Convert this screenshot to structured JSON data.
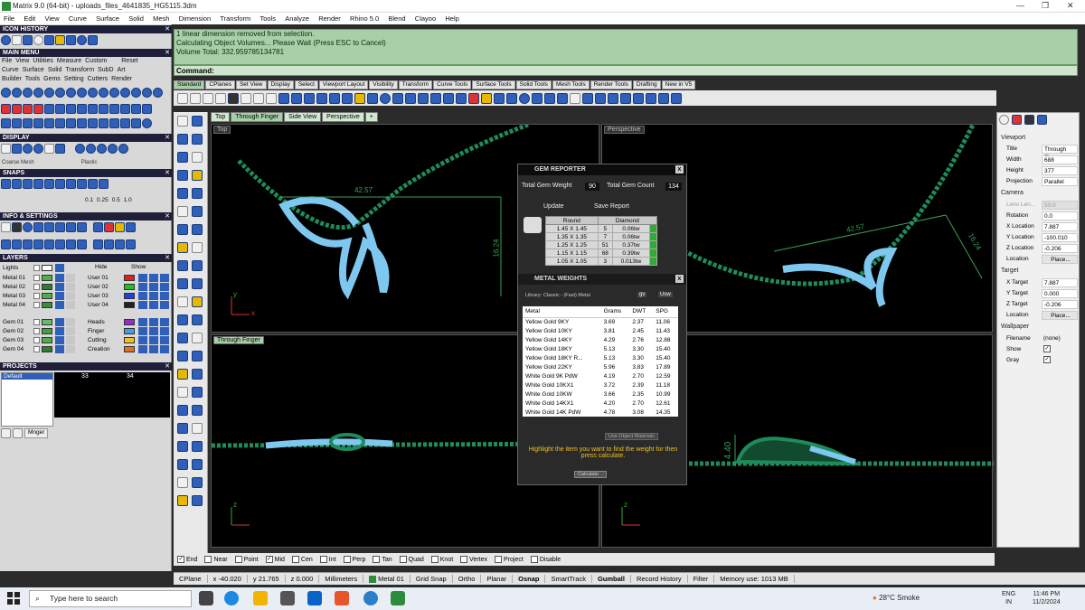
{
  "window": {
    "title": "Matrix 9.0 (64-bit) - uploads_files_4641835_HG5115.3dm",
    "min": "—",
    "max": "❐",
    "close": "✕"
  },
  "menu": [
    "File",
    "Edit",
    "View",
    "Curve",
    "Surface",
    "Solid",
    "Mesh",
    "Dimension",
    "Transform",
    "Tools",
    "Analyze",
    "Render",
    "Rhino 5.0",
    "Blend",
    "Clayoo",
    "Help"
  ],
  "left": {
    "icon_history": "ICON HISTORY",
    "main_menu": "MAIN MENU",
    "main_menu_row1": [
      "File",
      "View",
      "Utilities",
      "Measure",
      "Custom",
      "Reset"
    ],
    "main_menu_row2": [
      "Curve",
      "Surface",
      "Solid",
      "Transform",
      "SubD",
      "Art"
    ],
    "main_menu_row3": [
      "Builder",
      "Tools",
      "Gems",
      "Setting",
      "Cutters",
      "Render"
    ],
    "display": "DISPLAY",
    "display_left": "Coarse Mesh",
    "display_right": "Plastic",
    "snaps": "SNAPS",
    "snap_vals": [
      "0.1",
      "0.25",
      "0.5",
      "1.0"
    ],
    "info_settings": "INFO & SETTINGS",
    "layers": "LAYERS",
    "lights": "Lights",
    "hide": "Hide",
    "show": "Show",
    "layers_left": [
      "Metal 01",
      "Metal 02",
      "Metal 03",
      "Metal 04",
      "",
      "Gem 01",
      "Gem 02",
      "Gem 03",
      "Gem 04"
    ],
    "layers_right": [
      "User 01",
      "User 02",
      "User 03",
      "User 04",
      "",
      "Heads",
      "Finger",
      "Cutting",
      "Creation"
    ],
    "layer_colors_left": [
      "#4caf50",
      "#2e7d32",
      "#4caf50",
      "#388e3c",
      "",
      "#66bb6a",
      "#43a047",
      "#4caf50",
      "#2e7d32"
    ],
    "layer_colors_right": [
      "#e02020",
      "#20c020",
      "#2040e0",
      "#202020",
      "",
      "#9030c0",
      "#40a0e0",
      "#f0c020",
      "#e07020"
    ],
    "projects": "PROJECTS",
    "default": "Default",
    "frame_nums": [
      "33",
      "34"
    ],
    "mnger": "Mnger"
  },
  "command": {
    "lines": [
      "1 linear dimension removed from selection.",
      "Calculating Object Volumes... Please Wait (Press ESC to Cancel)",
      "Volume Total: 332.959785134781"
    ],
    "prompt": "Command:"
  },
  "toolbar_tabs": [
    "Standard",
    "CPlanes",
    "Set View",
    "Display",
    "Select",
    "Viewport Layout",
    "Visibility",
    "Transform",
    "Curve Tools",
    "Surface Tools",
    "Solid Tools",
    "Mesh Tools",
    "Render Tools",
    "Drafting",
    "New in V5"
  ],
  "viewport_tabs": [
    "Top",
    "Through Finger",
    "Side View",
    "Perspective",
    "+"
  ],
  "viewports": {
    "top": "Top",
    "perspective": "Perspective",
    "through_finger": "Through Finger",
    "dim_top_h": "42.57",
    "dim_top_v": "16.24",
    "dim_persp_h": "42.57",
    "dim_persp_v": "16.24",
    "dim_side": "4.40",
    "axis_x": "x",
    "axis_y": "y",
    "axis_z": "z"
  },
  "gem_reporter": {
    "title": "GEM REPORTER",
    "close": "x",
    "total_weight_label": "Total Gem Weight",
    "total_weight": "90",
    "total_count_label": "Total Gem Count",
    "total_count": "134",
    "update": "Update",
    "save_report": "Save Report",
    "headers": [
      "Round",
      "Diamond"
    ],
    "rows": [
      {
        "size": "1.45 X 1.45",
        "count": "5",
        "wt": "0.06tw"
      },
      {
        "size": "1.35 X 1.35",
        "count": "7",
        "wt": "0.06tw"
      },
      {
        "size": "1.25 X 1.25",
        "count": "51",
        "wt": "0.37tw"
      },
      {
        "size": "1.15 X 1.15",
        "count": "68",
        "wt": "0.39tw"
      },
      {
        "size": "1.05 X 1.05",
        "count": "3",
        "wt": "0.013tw"
      }
    ]
  },
  "metal_weights": {
    "title": "METAL WEIGHTS",
    "close": "x",
    "library": "Library: Classic - (Fast) Metal",
    "btn_gv": "gv",
    "btn_usw": "Usw",
    "headers": [
      "Metal",
      "Grams",
      "DWT",
      "SPG"
    ],
    "rows": [
      [
        "Yellow Gold 9KY",
        "3.69",
        "2.37",
        "11.06"
      ],
      [
        "Yellow Gold 10KY",
        "3.81",
        "2.45",
        "11.43"
      ],
      [
        "Yellow Gold 14KY",
        "4.29",
        "2.76",
        "12.88"
      ],
      [
        "Yellow Gold 18KY",
        "5.13",
        "3.30",
        "15.40"
      ],
      [
        "Yellow Gold 18KY R...",
        "5.13",
        "3.30",
        "15.40"
      ],
      [
        "Yellow Gold 22KY",
        "5.96",
        "3.83",
        "17.89"
      ],
      [
        "White Gold 9K PdW",
        "4.19",
        "2.70",
        "12.59"
      ],
      [
        "White Gold 10KX1",
        "3.72",
        "2.39",
        "11.18"
      ],
      [
        "White Gold 10KW",
        "3.66",
        "2.35",
        "10.99"
      ],
      [
        "White Gold 14KX1",
        "4.20",
        "2.70",
        "12.61"
      ],
      [
        "White Gold 14K PdW",
        "4.78",
        "3.08",
        "14.35"
      ]
    ],
    "use_object_materials": "Use Object Materials",
    "hint": "Highlight the item you want to find the weight for then press calculate.",
    "calculate": "Calculate"
  },
  "properties": {
    "viewport_cat": "Viewport",
    "title_k": "Title",
    "title_v": "Through Fi...",
    "width_k": "Width",
    "width_v": "688",
    "height_k": "Height",
    "height_v": "377",
    "projection_k": "Projection",
    "projection_v": "Parallel",
    "camera_cat": "Camera",
    "lens_k": "Lens Len...",
    "lens_v": "50.0",
    "rotation_k": "Rotation",
    "rotation_v": "0.0",
    "xloc_k": "X Location",
    "xloc_v": "7.887",
    "yloc_k": "Y Location",
    "yloc_v": "-100.010",
    "zloc_k": "Z Location",
    "zloc_v": "-0.206",
    "loc_k": "Location",
    "loc_v": "Place...",
    "target_cat": "Target",
    "xt_k": "X Target",
    "xt_v": "7.887",
    "yt_k": "Y Target",
    "yt_v": "0.000",
    "zt_k": "Z Target",
    "zt_v": "-0.206",
    "tloc_k": "Location",
    "tloc_v": "Place...",
    "wallpaper_cat": "Wallpaper",
    "fname_k": "Filename",
    "fname_v": "(none)",
    "show_k": "Show",
    "gray_k": "Gray"
  },
  "osnap": [
    {
      "label": "End",
      "on": true
    },
    {
      "label": "Near",
      "on": false
    },
    {
      "label": "Point",
      "on": false
    },
    {
      "label": "Mid",
      "on": true
    },
    {
      "label": "Cen",
      "on": false
    },
    {
      "label": "Int",
      "on": false
    },
    {
      "label": "Perp",
      "on": false
    },
    {
      "label": "Tan",
      "on": false
    },
    {
      "label": "Quad",
      "on": false
    },
    {
      "label": "Knot",
      "on": false
    },
    {
      "label": "Vertex",
      "on": false
    },
    {
      "label": "Project",
      "on": false
    },
    {
      "label": "Disable",
      "on": false
    }
  ],
  "status": {
    "cplane": "CPlane",
    "x": "x -40.020",
    "y": "y 21.765",
    "z": "z 0.000",
    "units": "Millimeters",
    "layer": "Metal 01",
    "grid": "Grid Snap",
    "ortho": "Ortho",
    "planar": "Planar",
    "osnap": "Osnap",
    "smarttrack": "SmartTrack",
    "gumball": "Gumball",
    "history": "Record History",
    "filter": "Filter",
    "memory": "Memory use: 1013 MB"
  },
  "taskbar": {
    "search": "Type here to search",
    "weather": "28°C Smoke",
    "lang1": "ENG",
    "lang2": "IN",
    "time": "11:46 PM",
    "date": "11/2/2024"
  },
  "colors": {
    "accent_green": "#a8d0a8",
    "model_green": "#1e8c5a",
    "gem_blue": "#7ec8f0"
  }
}
